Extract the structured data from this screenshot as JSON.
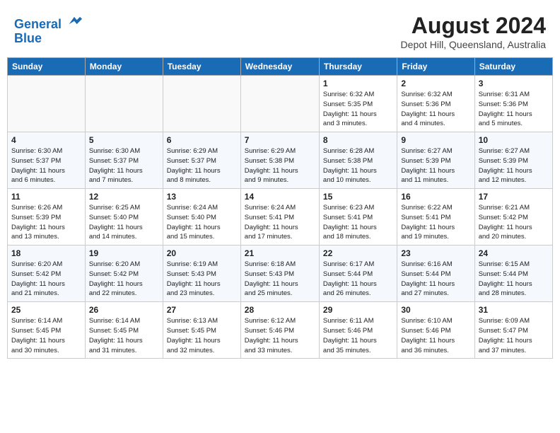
{
  "header": {
    "logo_line1": "General",
    "logo_line2": "Blue",
    "month_title": "August 2024",
    "location": "Depot Hill, Queensland, Australia"
  },
  "weekdays": [
    "Sunday",
    "Monday",
    "Tuesday",
    "Wednesday",
    "Thursday",
    "Friday",
    "Saturday"
  ],
  "weeks": [
    [
      {
        "day": "",
        "info": ""
      },
      {
        "day": "",
        "info": ""
      },
      {
        "day": "",
        "info": ""
      },
      {
        "day": "",
        "info": ""
      },
      {
        "day": "1",
        "info": "Sunrise: 6:32 AM\nSunset: 5:35 PM\nDaylight: 11 hours\nand 3 minutes."
      },
      {
        "day": "2",
        "info": "Sunrise: 6:32 AM\nSunset: 5:36 PM\nDaylight: 11 hours\nand 4 minutes."
      },
      {
        "day": "3",
        "info": "Sunrise: 6:31 AM\nSunset: 5:36 PM\nDaylight: 11 hours\nand 5 minutes."
      }
    ],
    [
      {
        "day": "4",
        "info": "Sunrise: 6:30 AM\nSunset: 5:37 PM\nDaylight: 11 hours\nand 6 minutes."
      },
      {
        "day": "5",
        "info": "Sunrise: 6:30 AM\nSunset: 5:37 PM\nDaylight: 11 hours\nand 7 minutes."
      },
      {
        "day": "6",
        "info": "Sunrise: 6:29 AM\nSunset: 5:37 PM\nDaylight: 11 hours\nand 8 minutes."
      },
      {
        "day": "7",
        "info": "Sunrise: 6:29 AM\nSunset: 5:38 PM\nDaylight: 11 hours\nand 9 minutes."
      },
      {
        "day": "8",
        "info": "Sunrise: 6:28 AM\nSunset: 5:38 PM\nDaylight: 11 hours\nand 10 minutes."
      },
      {
        "day": "9",
        "info": "Sunrise: 6:27 AM\nSunset: 5:39 PM\nDaylight: 11 hours\nand 11 minutes."
      },
      {
        "day": "10",
        "info": "Sunrise: 6:27 AM\nSunset: 5:39 PM\nDaylight: 11 hours\nand 12 minutes."
      }
    ],
    [
      {
        "day": "11",
        "info": "Sunrise: 6:26 AM\nSunset: 5:39 PM\nDaylight: 11 hours\nand 13 minutes."
      },
      {
        "day": "12",
        "info": "Sunrise: 6:25 AM\nSunset: 5:40 PM\nDaylight: 11 hours\nand 14 minutes."
      },
      {
        "day": "13",
        "info": "Sunrise: 6:24 AM\nSunset: 5:40 PM\nDaylight: 11 hours\nand 15 minutes."
      },
      {
        "day": "14",
        "info": "Sunrise: 6:24 AM\nSunset: 5:41 PM\nDaylight: 11 hours\nand 17 minutes."
      },
      {
        "day": "15",
        "info": "Sunrise: 6:23 AM\nSunset: 5:41 PM\nDaylight: 11 hours\nand 18 minutes."
      },
      {
        "day": "16",
        "info": "Sunrise: 6:22 AM\nSunset: 5:41 PM\nDaylight: 11 hours\nand 19 minutes."
      },
      {
        "day": "17",
        "info": "Sunrise: 6:21 AM\nSunset: 5:42 PM\nDaylight: 11 hours\nand 20 minutes."
      }
    ],
    [
      {
        "day": "18",
        "info": "Sunrise: 6:20 AM\nSunset: 5:42 PM\nDaylight: 11 hours\nand 21 minutes."
      },
      {
        "day": "19",
        "info": "Sunrise: 6:20 AM\nSunset: 5:42 PM\nDaylight: 11 hours\nand 22 minutes."
      },
      {
        "day": "20",
        "info": "Sunrise: 6:19 AM\nSunset: 5:43 PM\nDaylight: 11 hours\nand 23 minutes."
      },
      {
        "day": "21",
        "info": "Sunrise: 6:18 AM\nSunset: 5:43 PM\nDaylight: 11 hours\nand 25 minutes."
      },
      {
        "day": "22",
        "info": "Sunrise: 6:17 AM\nSunset: 5:44 PM\nDaylight: 11 hours\nand 26 minutes."
      },
      {
        "day": "23",
        "info": "Sunrise: 6:16 AM\nSunset: 5:44 PM\nDaylight: 11 hours\nand 27 minutes."
      },
      {
        "day": "24",
        "info": "Sunrise: 6:15 AM\nSunset: 5:44 PM\nDaylight: 11 hours\nand 28 minutes."
      }
    ],
    [
      {
        "day": "25",
        "info": "Sunrise: 6:14 AM\nSunset: 5:45 PM\nDaylight: 11 hours\nand 30 minutes."
      },
      {
        "day": "26",
        "info": "Sunrise: 6:14 AM\nSunset: 5:45 PM\nDaylight: 11 hours\nand 31 minutes."
      },
      {
        "day": "27",
        "info": "Sunrise: 6:13 AM\nSunset: 5:45 PM\nDaylight: 11 hours\nand 32 minutes."
      },
      {
        "day": "28",
        "info": "Sunrise: 6:12 AM\nSunset: 5:46 PM\nDaylight: 11 hours\nand 33 minutes."
      },
      {
        "day": "29",
        "info": "Sunrise: 6:11 AM\nSunset: 5:46 PM\nDaylight: 11 hours\nand 35 minutes."
      },
      {
        "day": "30",
        "info": "Sunrise: 6:10 AM\nSunset: 5:46 PM\nDaylight: 11 hours\nand 36 minutes."
      },
      {
        "day": "31",
        "info": "Sunrise: 6:09 AM\nSunset: 5:47 PM\nDaylight: 11 hours\nand 37 minutes."
      }
    ]
  ]
}
